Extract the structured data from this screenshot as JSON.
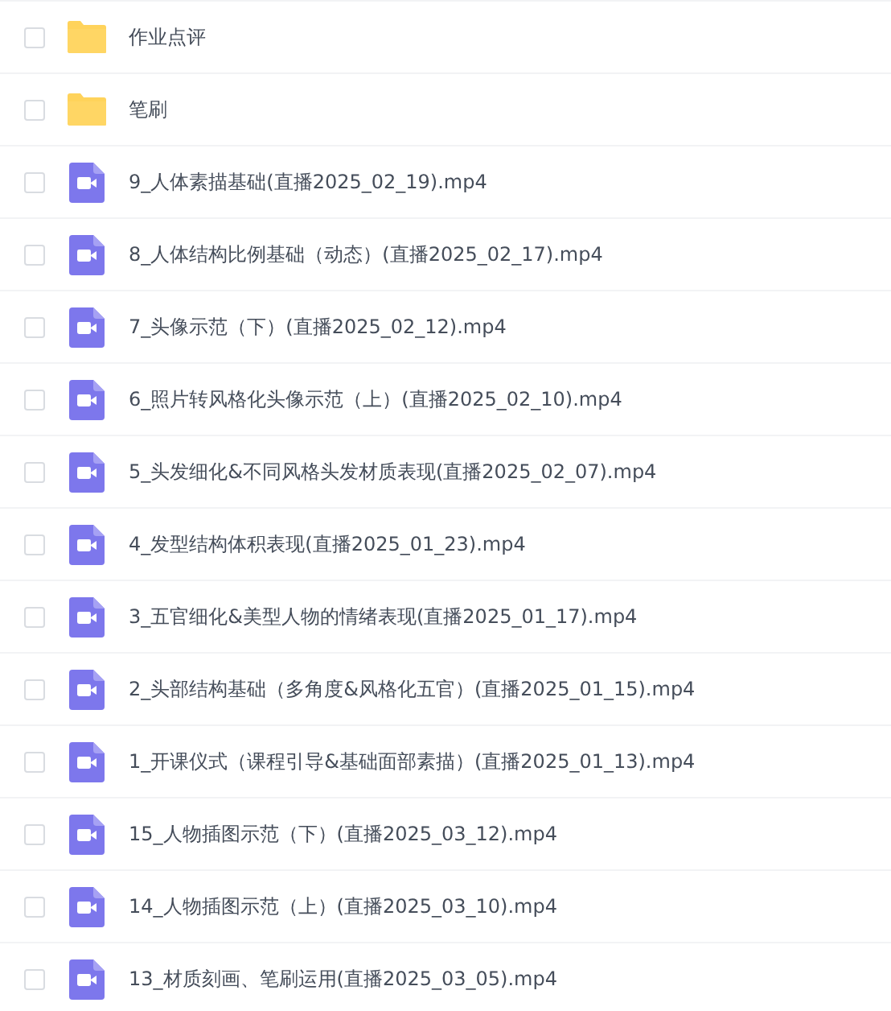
{
  "files": [
    {
      "kind": "folder",
      "name": "作业点评",
      "checked": false
    },
    {
      "kind": "folder",
      "name": "笔刷",
      "checked": false
    },
    {
      "kind": "video",
      "name": "9_人体素描基础(直播2025_02_19).mp4",
      "checked": false
    },
    {
      "kind": "video",
      "name": "8_人体结构比例基础（动态）(直播2025_02_17).mp4",
      "checked": false
    },
    {
      "kind": "video",
      "name": "7_头像示范（下）(直播2025_02_12).mp4",
      "checked": false
    },
    {
      "kind": "video",
      "name": "6_照片转风格化头像示范（上）(直播2025_02_10).mp4",
      "checked": false
    },
    {
      "kind": "video",
      "name": "5_头发细化&不同风格头发材质表现(直播2025_02_07).mp4",
      "checked": false
    },
    {
      "kind": "video",
      "name": "4_发型结构体积表现(直播2025_01_23).mp4",
      "checked": false
    },
    {
      "kind": "video",
      "name": "3_五官细化&美型人物的情绪表现(直播2025_01_17).mp4",
      "checked": false
    },
    {
      "kind": "video",
      "name": "2_头部结构基础（多角度&风格化五官）(直播2025_01_15).mp4",
      "checked": false
    },
    {
      "kind": "video",
      "name": "1_开课仪式（课程引导&基础面部素描）(直播2025_01_13).mp4",
      "checked": false
    },
    {
      "kind": "video",
      "name": "15_人物插图示范（下）(直播2025_03_12).mp4",
      "checked": false
    },
    {
      "kind": "video",
      "name": "14_人物插图示范（上）(直播2025_03_10).mp4",
      "checked": false
    },
    {
      "kind": "video",
      "name": "13_材质刻画、笔刷运用(直播2025_03_05).mp4",
      "checked": false
    }
  ]
}
